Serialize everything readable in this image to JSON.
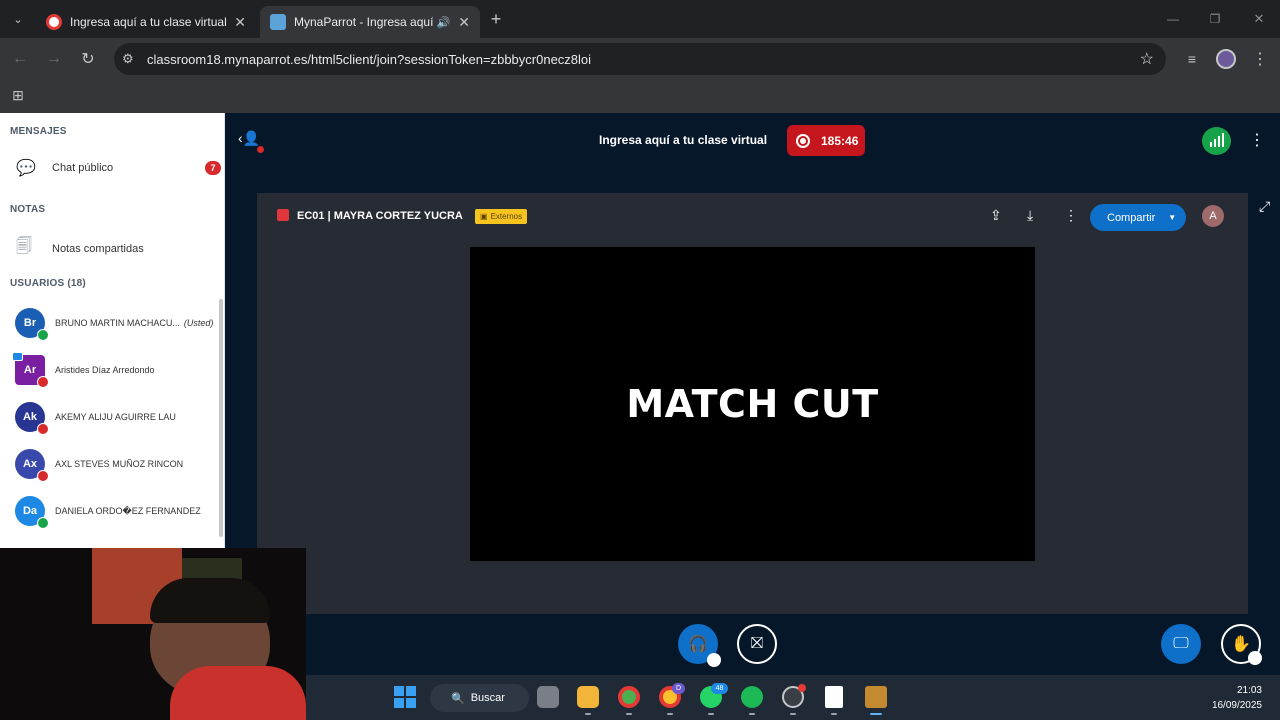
{
  "browser": {
    "tabs": [
      {
        "title": "Ingresa aquí a tu clase virtual",
        "active": false
      },
      {
        "title": "MynaParrot - Ingresa aquí a",
        "active": true
      }
    ],
    "url": "classroom18.mynaparrot.es/html5client/join?sessionToken=zbbbycr0necz8loi"
  },
  "sidebar": {
    "messages_title": "MENSAJES",
    "public_chat": "Chat público",
    "unread_count": "7",
    "notes_title": "NOTAS",
    "shared_notes": "Notas compartidas",
    "users_title": "USUARIOS (18)",
    "users": [
      {
        "initials": "Br",
        "name": "BRUNO MARTIN MACHACU...",
        "you_label": "(Usted)",
        "color": "#1a5fb4",
        "status_color": "#16a34a"
      },
      {
        "initials": "Ar",
        "name": "Aristides Díaz Arredondo",
        "you_label": "",
        "color": "#7b1fa2",
        "status_color": "#d82a2a"
      },
      {
        "initials": "Ak",
        "name": "AKEMY ALIJU AGUIRRE LAU",
        "you_label": "",
        "color": "#283593",
        "status_color": "#d82a2a"
      },
      {
        "initials": "Ax",
        "name": "AXL STEVES MUÑOZ RINCON",
        "you_label": "",
        "color": "#3949ab",
        "status_color": "#d82a2a"
      },
      {
        "initials": "Da",
        "name": "DANIELA ORDO�EZ FERNANDEZ",
        "you_label": "",
        "color": "#1e88e5",
        "status_color": "#16a34a"
      }
    ]
  },
  "header": {
    "title": "Ingresa aquí a tu clase virtual",
    "recording_time": "185:46"
  },
  "presentation": {
    "title": "EC01 | MAYRA CORTEZ YUCRA",
    "badge": "Externos",
    "share_label": "Compartir",
    "account_initial": "A",
    "slide_text": "MATCH CUT"
  },
  "taskbar": {
    "search_label": "Buscar",
    "time": "21:03",
    "date": "16/09/2025",
    "chrome_badge": "D",
    "whatsapp_badge": "48"
  }
}
